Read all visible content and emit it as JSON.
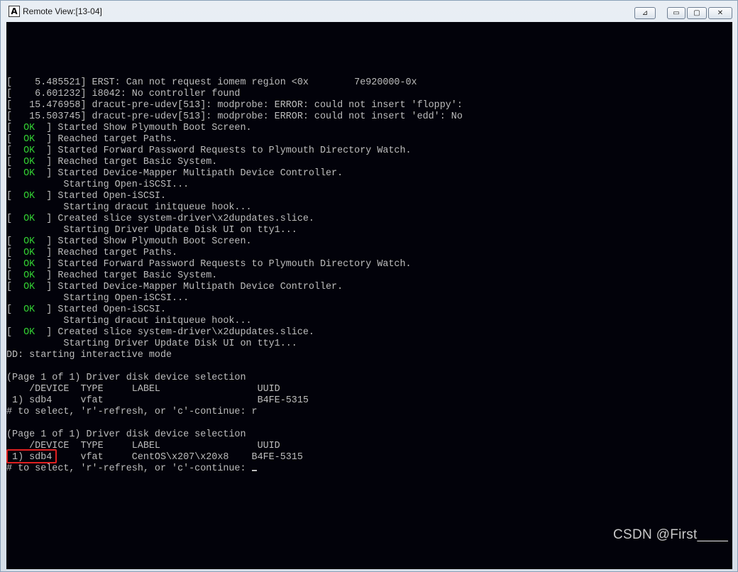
{
  "window": {
    "title": "Remote View:[13-04]",
    "app_icon_glyph": "A",
    "controls": {
      "pin": "⊿",
      "minimize": "▭",
      "maximize": "▢",
      "close": "✕"
    }
  },
  "colors": {
    "background": "#02020a",
    "text": "#bdbdbd",
    "ok": "#33d233",
    "highlight": "#e02020"
  },
  "console_lines": [
    {
      "pre": "[    5.485521] ERST: Can not request iomem region <0x        7e920000-0x",
      "ok": "",
      "post": ""
    },
    {
      "pre": "[    6.601232] i8042: No controller found",
      "ok": "",
      "post": ""
    },
    {
      "pre": "[   15.476958] dracut-pre-udev[513]: modprobe: ERROR: could not insert 'floppy':",
      "ok": "",
      "post": ""
    },
    {
      "pre": "[   15.503745] dracut-pre-udev[513]: modprobe: ERROR: could not insert 'edd': No",
      "ok": "",
      "post": ""
    },
    {
      "pre": "[  ",
      "ok": "OK",
      "post": "  ] Started Show Plymouth Boot Screen."
    },
    {
      "pre": "[  ",
      "ok": "OK",
      "post": "  ] Reached target Paths."
    },
    {
      "pre": "[  ",
      "ok": "OK",
      "post": "  ] Started Forward Password Requests to Plymouth Directory Watch."
    },
    {
      "pre": "[  ",
      "ok": "OK",
      "post": "  ] Reached target Basic System."
    },
    {
      "pre": "[  ",
      "ok": "OK",
      "post": "  ] Started Device-Mapper Multipath Device Controller."
    },
    {
      "pre": "          Starting Open-iSCSI...",
      "ok": "",
      "post": ""
    },
    {
      "pre": "[  ",
      "ok": "OK",
      "post": "  ] Started Open-iSCSI."
    },
    {
      "pre": "          Starting dracut initqueue hook...",
      "ok": "",
      "post": ""
    },
    {
      "pre": "[  ",
      "ok": "OK",
      "post": "  ] Created slice system-driver\\x2dupdates.slice."
    },
    {
      "pre": "          Starting Driver Update Disk UI on tty1...",
      "ok": "",
      "post": ""
    },
    {
      "pre": "[  ",
      "ok": "OK",
      "post": "  ] Started Show Plymouth Boot Screen."
    },
    {
      "pre": "[  ",
      "ok": "OK",
      "post": "  ] Reached target Paths."
    },
    {
      "pre": "[  ",
      "ok": "OK",
      "post": "  ] Started Forward Password Requests to Plymouth Directory Watch."
    },
    {
      "pre": "[  ",
      "ok": "OK",
      "post": "  ] Reached target Basic System."
    },
    {
      "pre": "[  ",
      "ok": "OK",
      "post": "  ] Started Device-Mapper Multipath Device Controller."
    },
    {
      "pre": "          Starting Open-iSCSI...",
      "ok": "",
      "post": ""
    },
    {
      "pre": "[  ",
      "ok": "OK",
      "post": "  ] Started Open-iSCSI."
    },
    {
      "pre": "          Starting dracut initqueue hook...",
      "ok": "",
      "post": ""
    },
    {
      "pre": "[  ",
      "ok": "OK",
      "post": "  ] Created slice system-driver\\x2dupdates.slice."
    },
    {
      "pre": "          Starting Driver Update Disk UI on tty1...",
      "ok": "",
      "post": ""
    },
    {
      "pre": "DD: starting interactive mode",
      "ok": "",
      "post": ""
    },
    {
      "pre": "",
      "ok": "",
      "post": ""
    },
    {
      "pre": "(Page 1 of 1) Driver disk device selection",
      "ok": "",
      "post": ""
    },
    {
      "pre": "    /DEVICE  TYPE     LABEL                 UUID",
      "ok": "",
      "post": ""
    },
    {
      "pre": " 1) sdb4     vfat                           B4FE-5315",
      "ok": "",
      "post": ""
    },
    {
      "pre": "# to select, 'r'-refresh, or 'c'-continue: r",
      "ok": "",
      "post": ""
    },
    {
      "pre": "",
      "ok": "",
      "post": ""
    },
    {
      "pre": "(Page 1 of 1) Driver disk device selection",
      "ok": "",
      "post": ""
    },
    {
      "pre": "    /DEVICE  TYPE     LABEL                 UUID",
      "ok": "",
      "post": ""
    },
    {
      "pre": " 1) sdb4     vfat     CentOS\\x207\\x20x8    B4FE-5315",
      "ok": "",
      "post": ""
    },
    {
      "pre": "# to select, 'r'-refresh, or 'c'-continue: ",
      "ok": "",
      "post": ""
    }
  ],
  "watermark": "CSDN @First____"
}
